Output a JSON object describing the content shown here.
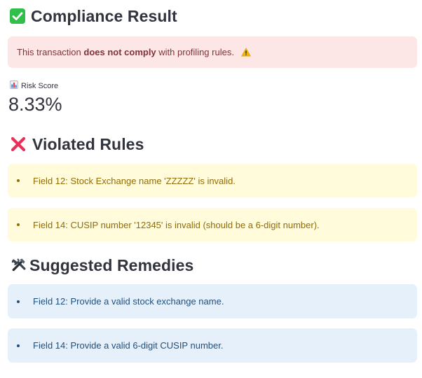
{
  "compliance": {
    "title": "Compliance Result",
    "alert": {
      "prefix": "This transaction ",
      "bold": "does not comply",
      "suffix": " with profiling rules."
    }
  },
  "metric": {
    "label": "Risk Score",
    "value": "8.33%"
  },
  "violated": {
    "title": "Violated Rules",
    "items": [
      "Field 12: Stock Exchange name 'ZZZZZ' is invalid.",
      "Field 14: CUSIP number '12345' is invalid (should be a 6-digit number)."
    ]
  },
  "remedies": {
    "title": "Suggested Remedies",
    "items": [
      "Field 12: Provide a valid stock exchange name.",
      "Field 14: Provide a valid 6-digit CUSIP number."
    ]
  },
  "icons": {
    "compliance": "check-mark-button-icon",
    "alert": "warning-icon",
    "metric": "bar-chart-icon",
    "violated": "cross-mark-icon",
    "remedies": "hammer-and-wrench-icon"
  },
  "colors": {
    "error_bg": "#fde6e6",
    "error_text": "#7d353b",
    "warning_bg": "#fffbdb",
    "warning_text": "#926c05",
    "info_bg": "#e5f0fb",
    "info_text": "#1f4f7c",
    "check_green": "#2fbf4a",
    "cross_red": "#e8305a"
  }
}
